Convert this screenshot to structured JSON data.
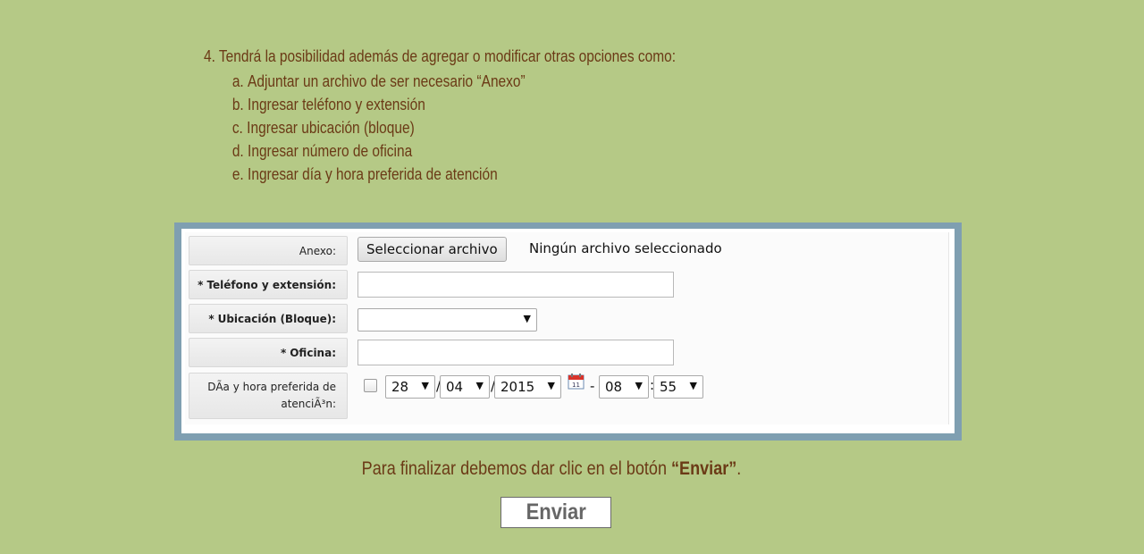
{
  "instructions": {
    "lead": "4. Tendrá la posibilidad además de agregar o modificar otras opciones como:",
    "items": [
      {
        "mark": "a.",
        "text": "Adjuntar un archivo de ser necesario “Anexo”"
      },
      {
        "mark": "b.",
        "text": "Ingresar teléfono y extensión"
      },
      {
        "mark": "c.",
        "text": "Ingresar ubicación (bloque)"
      },
      {
        "mark": "d.",
        "text": "Ingresar número de oficina"
      },
      {
        "mark": "e.",
        "text": "Ingresar día y hora preferida de atención"
      }
    ]
  },
  "form": {
    "anexo": {
      "label": "Anexo:",
      "button": "Seleccionar archivo",
      "status": "Ningún archivo seleccionado"
    },
    "telefono": {
      "star": "*",
      "label": "Teléfono y extensión:",
      "value": ""
    },
    "ubicacion": {
      "star": "*",
      "label": "Ubicación (Bloque):",
      "selected": ""
    },
    "oficina": {
      "star": "*",
      "label": "Oficina:",
      "value": ""
    },
    "fecha": {
      "label_line1": "DÃa y hora preferida de",
      "label_line2": "atenciÃ³n:",
      "day": "28",
      "month": "04",
      "year": "2015",
      "hour": "08",
      "minute": "55",
      "date_sep": "/",
      "dash": "-",
      "colon": ":",
      "checked": false
    }
  },
  "footer": {
    "text_before": "Para finalizar debemos dar clic en el botón ",
    "text_bold": "“Enviar”",
    "text_after": ".",
    "button_label": "Enviar"
  },
  "colors": {
    "background": "#b5c986",
    "text_brown": "#6b3a16",
    "frame": "#7f9fb1"
  }
}
